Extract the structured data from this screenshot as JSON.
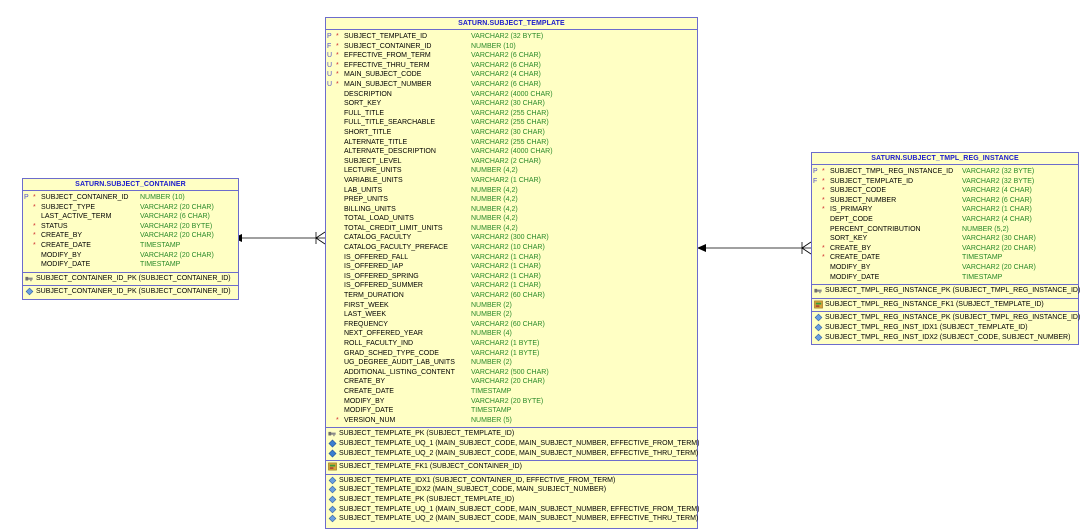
{
  "tables": [
    {
      "id": "container",
      "title": "SATURN.SUBJECT_CONTAINER",
      "columns": [
        {
          "key": "P",
          "req": "*",
          "name": "SUBJECT_CONTAINER_ID",
          "type": "NUMBER (10)"
        },
        {
          "key": "",
          "req": "*",
          "name": "SUBJECT_TYPE",
          "type": "VARCHAR2 (20 CHAR)"
        },
        {
          "key": "",
          "req": "",
          "name": "LAST_ACTIVE_TERM",
          "type": "VARCHAR2 (6 CHAR)"
        },
        {
          "key": "",
          "req": "*",
          "name": "STATUS",
          "type": "VARCHAR2 (20 BYTE)"
        },
        {
          "key": "",
          "req": "*",
          "name": "CREATE_BY",
          "type": "VARCHAR2 (20 CHAR)"
        },
        {
          "key": "",
          "req": "*",
          "name": "CREATE_DATE",
          "type": "TIMESTAMP"
        },
        {
          "key": "",
          "req": "",
          "name": "MODIFY_BY",
          "type": "VARCHAR2 (20 CHAR)"
        },
        {
          "key": "",
          "req": "",
          "name": "MODIFY_DATE",
          "type": "TIMESTAMP"
        }
      ],
      "sections": [
        [
          {
            "icon": "pk-key-icon",
            "text": "SUBJECT_CONTAINER_ID_PK (SUBJECT_CONTAINER_ID)"
          }
        ],
        [
          {
            "icon": "index-diamond-icon",
            "text": "SUBJECT_CONTAINER_ID_PK (SUBJECT_CONTAINER_ID)"
          }
        ]
      ]
    },
    {
      "id": "template",
      "title": "SATURN.SUBJECT_TEMPLATE",
      "columns": [
        {
          "key": "P",
          "req": "*",
          "name": "SUBJECT_TEMPLATE_ID",
          "type": "VARCHAR2 (32 BYTE)"
        },
        {
          "key": "F",
          "req": "*",
          "name": "SUBJECT_CONTAINER_ID",
          "type": "NUMBER (10)"
        },
        {
          "key": "U",
          "req": "*",
          "name": "EFFECTIVE_FROM_TERM",
          "type": "VARCHAR2 (6 CHAR)"
        },
        {
          "key": "U",
          "req": "*",
          "name": "EFFECTIVE_THRU_TERM",
          "type": "VARCHAR2 (6 CHAR)"
        },
        {
          "key": "U",
          "req": "*",
          "name": "MAIN_SUBJECT_CODE",
          "type": "VARCHAR2 (4 CHAR)"
        },
        {
          "key": "U",
          "req": "*",
          "name": "MAIN_SUBJECT_NUMBER",
          "type": "VARCHAR2 (6 CHAR)"
        },
        {
          "key": "",
          "req": "",
          "name": "DESCRIPTION",
          "type": "VARCHAR2 (4000 CHAR)"
        },
        {
          "key": "",
          "req": "",
          "name": "SORT_KEY",
          "type": "VARCHAR2 (30 CHAR)"
        },
        {
          "key": "",
          "req": "",
          "name": "FULL_TITLE",
          "type": "VARCHAR2 (255 CHAR)"
        },
        {
          "key": "",
          "req": "",
          "name": "FULL_TITLE_SEARCHABLE",
          "type": "VARCHAR2 (255 CHAR)"
        },
        {
          "key": "",
          "req": "",
          "name": "SHORT_TITLE",
          "type": "VARCHAR2 (30 CHAR)"
        },
        {
          "key": "",
          "req": "",
          "name": "ALTERNATE_TITLE",
          "type": "VARCHAR2 (255 CHAR)"
        },
        {
          "key": "",
          "req": "",
          "name": "ALTERNATE_DESCRIPTION",
          "type": "VARCHAR2 (4000 CHAR)"
        },
        {
          "key": "",
          "req": "",
          "name": "SUBJECT_LEVEL",
          "type": "VARCHAR2 (2 CHAR)"
        },
        {
          "key": "",
          "req": "",
          "name": "LECTURE_UNITS",
          "type": "NUMBER (4,2)"
        },
        {
          "key": "",
          "req": "",
          "name": "VARIABLE_UNITS",
          "type": "VARCHAR2 (1 CHAR)"
        },
        {
          "key": "",
          "req": "",
          "name": "LAB_UNITS",
          "type": "NUMBER (4,2)"
        },
        {
          "key": "",
          "req": "",
          "name": "PREP_UNITS",
          "type": "NUMBER (4,2)"
        },
        {
          "key": "",
          "req": "",
          "name": "BILLING_UNITS",
          "type": "NUMBER (4,2)"
        },
        {
          "key": "",
          "req": "",
          "name": "TOTAL_LOAD_UNITS",
          "type": "NUMBER (4,2)"
        },
        {
          "key": "",
          "req": "",
          "name": "TOTAL_CREDIT_LIMIT_UNITS",
          "type": "NUMBER (4,2)"
        },
        {
          "key": "",
          "req": "",
          "name": "CATALOG_FACULTY",
          "type": "VARCHAR2 (300 CHAR)"
        },
        {
          "key": "",
          "req": "",
          "name": "CATALOG_FACULTY_PREFACE",
          "type": "VARCHAR2 (10 CHAR)"
        },
        {
          "key": "",
          "req": "",
          "name": "IS_OFFERED_FALL",
          "type": "VARCHAR2 (1 CHAR)"
        },
        {
          "key": "",
          "req": "",
          "name": "IS_OFFERED_IAP",
          "type": "VARCHAR2 (1 CHAR)"
        },
        {
          "key": "",
          "req": "",
          "name": "IS_OFFERED_SPRING",
          "type": "VARCHAR2 (1 CHAR)"
        },
        {
          "key": "",
          "req": "",
          "name": "IS_OFFERED_SUMMER",
          "type": "VARCHAR2 (1 CHAR)"
        },
        {
          "key": "",
          "req": "",
          "name": "TERM_DURATION",
          "type": "VARCHAR2 (60 CHAR)"
        },
        {
          "key": "",
          "req": "",
          "name": "FIRST_WEEK",
          "type": "NUMBER (2)"
        },
        {
          "key": "",
          "req": "",
          "name": "LAST_WEEK",
          "type": "NUMBER (2)"
        },
        {
          "key": "",
          "req": "",
          "name": "FREQUENCY",
          "type": "VARCHAR2 (60 CHAR)"
        },
        {
          "key": "",
          "req": "",
          "name": "NEXT_OFFERED_YEAR",
          "type": "NUMBER (4)"
        },
        {
          "key": "",
          "req": "",
          "name": "ROLL_FACULTY_IND",
          "type": "VARCHAR2 (1 BYTE)"
        },
        {
          "key": "",
          "req": "",
          "name": "GRAD_SCHED_TYPE_CODE",
          "type": "VARCHAR2 (1 BYTE)"
        },
        {
          "key": "",
          "req": "",
          "name": "UG_DEGREE_AUDIT_LAB_UNITS",
          "type": "NUMBER (2)"
        },
        {
          "key": "",
          "req": "",
          "name": "ADDITIONAL_LISTING_CONTENT",
          "type": "VARCHAR2 (500 CHAR)"
        },
        {
          "key": "",
          "req": "",
          "name": "CREATE_BY",
          "type": "VARCHAR2 (20 CHAR)"
        },
        {
          "key": "",
          "req": "",
          "name": "CREATE_DATE",
          "type": "TIMESTAMP"
        },
        {
          "key": "",
          "req": "",
          "name": "MODIFY_BY",
          "type": "VARCHAR2 (20 BYTE)"
        },
        {
          "key": "",
          "req": "",
          "name": "MODIFY_DATE",
          "type": "TIMESTAMP"
        },
        {
          "key": "",
          "req": "*",
          "name": "VERSION_NUM",
          "type": "NUMBER (5)"
        }
      ],
      "sections": [
        [
          {
            "icon": "pk-key-icon",
            "text": "SUBJECT_TEMPLATE_PK (SUBJECT_TEMPLATE_ID)"
          },
          {
            "icon": "unique-key-icon",
            "text": "SUBJECT_TEMPLATE_UQ_1 (MAIN_SUBJECT_CODE, MAIN_SUBJECT_NUMBER, EFFECTIVE_FROM_TERM)"
          },
          {
            "icon": "unique-key-icon",
            "text": "SUBJECT_TEMPLATE_UQ_2 (MAIN_SUBJECT_CODE, MAIN_SUBJECT_NUMBER, EFFECTIVE_THRU_TERM)"
          }
        ],
        [
          {
            "icon": "fk-key-icon",
            "text": "SUBJECT_TEMPLATE_FK1 (SUBJECT_CONTAINER_ID)"
          }
        ],
        [
          {
            "icon": "index-diamond-icon",
            "text": "SUBJECT_TEMPLATE_IDX1 (SUBJECT_CONTAINER_ID, EFFECTIVE_FROM_TERM)"
          },
          {
            "icon": "index-diamond-icon",
            "text": "SUBJECT_TEMPLATE_IDX2 (MAIN_SUBJECT_CODE, MAIN_SUBJECT_NUMBER)"
          },
          {
            "icon": "index-diamond-icon",
            "text": "SUBJECT_TEMPLATE_PK (SUBJECT_TEMPLATE_ID)"
          },
          {
            "icon": "index-diamond-icon",
            "text": "SUBJECT_TEMPLATE_UQ_1 (MAIN_SUBJECT_CODE, MAIN_SUBJECT_NUMBER, EFFECTIVE_FROM_TERM)"
          },
          {
            "icon": "index-diamond-icon",
            "text": "SUBJECT_TEMPLATE_UQ_2 (MAIN_SUBJECT_CODE, MAIN_SUBJECT_NUMBER, EFFECTIVE_THRU_TERM)"
          }
        ]
      ]
    },
    {
      "id": "reg",
      "title": "SATURN.SUBJECT_TMPL_REG_INSTANCE",
      "columns": [
        {
          "key": "P",
          "req": "*",
          "name": "SUBJECT_TMPL_REG_INSTANCE_ID",
          "type": "VARCHAR2 (32 BYTE)"
        },
        {
          "key": "F",
          "req": "*",
          "name": "SUBJECT_TEMPLATE_ID",
          "type": "VARCHAR2 (32 BYTE)"
        },
        {
          "key": "",
          "req": "*",
          "name": "SUBJECT_CODE",
          "type": "VARCHAR2 (4 CHAR)"
        },
        {
          "key": "",
          "req": "*",
          "name": "SUBJECT_NUMBER",
          "type": "VARCHAR2 (6 CHAR)"
        },
        {
          "key": "",
          "req": "*",
          "name": "IS_PRIMARY",
          "type": "VARCHAR2 (1 CHAR)"
        },
        {
          "key": "",
          "req": "",
          "name": "DEPT_CODE",
          "type": "VARCHAR2 (4 CHAR)"
        },
        {
          "key": "",
          "req": "",
          "name": "PERCENT_CONTRIBUTION",
          "type": "NUMBER (5,2)"
        },
        {
          "key": "",
          "req": "",
          "name": "SORT_KEY",
          "type": "VARCHAR2 (30 CHAR)"
        },
        {
          "key": "",
          "req": "*",
          "name": "CREATE_BY",
          "type": "VARCHAR2 (20 CHAR)"
        },
        {
          "key": "",
          "req": "*",
          "name": "CREATE_DATE",
          "type": "TIMESTAMP"
        },
        {
          "key": "",
          "req": "",
          "name": "MODIFY_BY",
          "type": "VARCHAR2 (20 CHAR)"
        },
        {
          "key": "",
          "req": "",
          "name": "MODIFY_DATE",
          "type": "TIMESTAMP"
        }
      ],
      "sections": [
        [
          {
            "icon": "pk-key-icon",
            "text": "SUBJECT_TMPL_REG_INSTANCE_PK (SUBJECT_TMPL_REG_INSTANCE_ID)"
          }
        ],
        [
          {
            "icon": "fk-key-icon",
            "text": "SUBJECT_TMPL_REG_INSTANCE_FK1 (SUBJECT_TEMPLATE_ID)"
          }
        ],
        [
          {
            "icon": "index-diamond-icon",
            "text": "SUBJECT_TMPL_REG_INSTANCE_PK (SUBJECT_TMPL_REG_INSTANCE_ID)"
          },
          {
            "icon": "index-diamond-icon",
            "text": "SUBJECT_TMPL_REG_INST_IDX1 (SUBJECT_TEMPLATE_ID)"
          },
          {
            "icon": "index-diamond-icon",
            "text": "SUBJECT_TMPL_REG_INST_IDX2 (SUBJECT_CODE, SUBJECT_NUMBER)"
          }
        ]
      ]
    }
  ],
  "colors": {
    "table_fill": "#ffffc4",
    "border": "#6c6ccc",
    "title_text": "#1a1acc",
    "type_text": "#2a8a2a",
    "required_star": "#d03030",
    "key_letter": "#5050c8"
  }
}
